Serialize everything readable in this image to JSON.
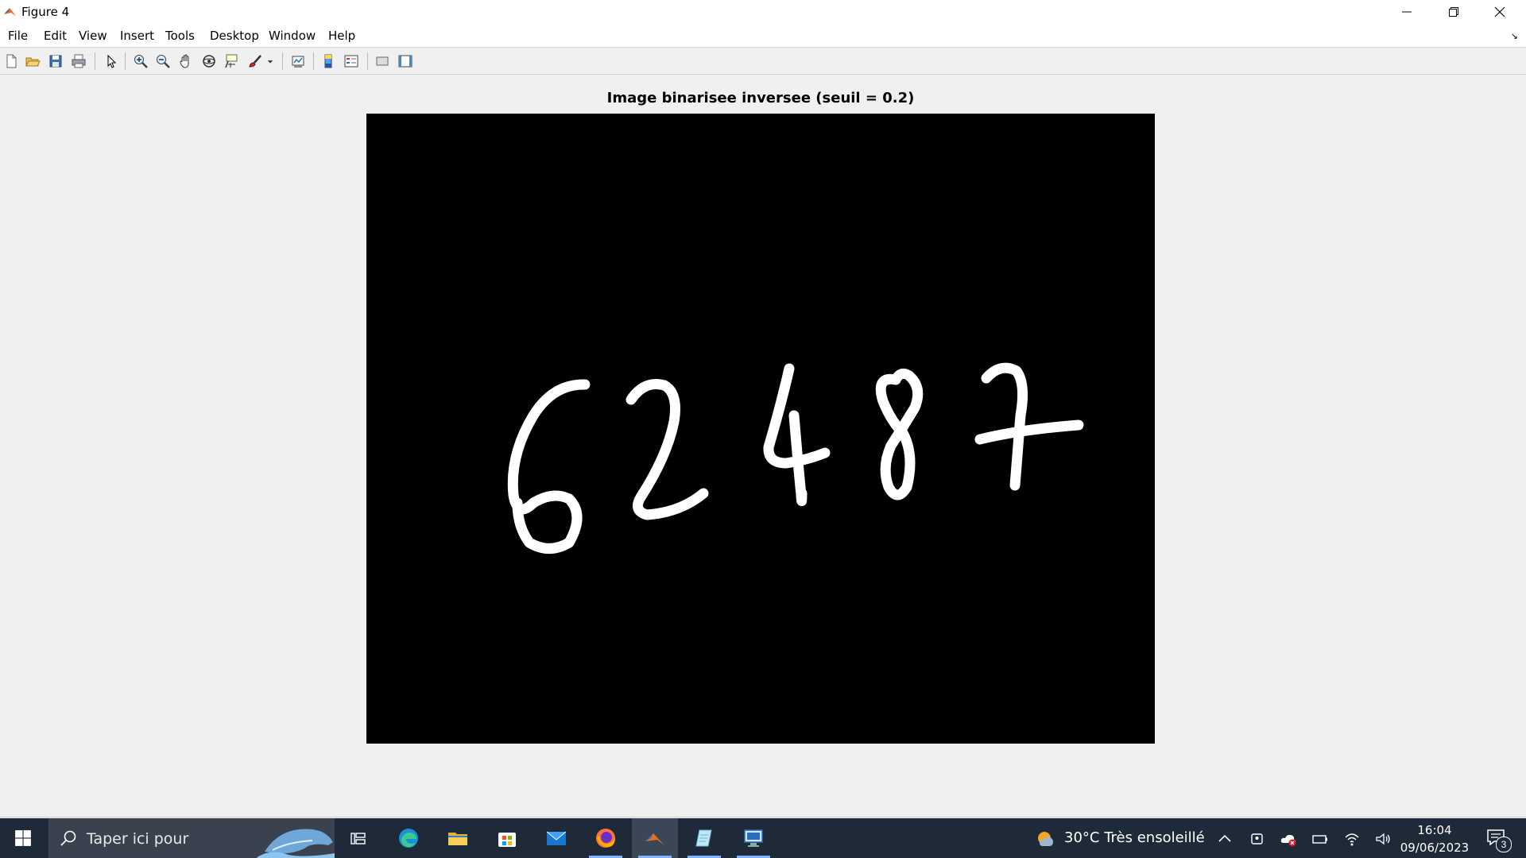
{
  "window": {
    "title": "Figure 4",
    "controls": [
      "minimize",
      "restore",
      "close"
    ]
  },
  "menu": {
    "items": [
      "File",
      "Edit",
      "View",
      "Insert",
      "Tools",
      "Desktop",
      "Window",
      "Help"
    ]
  },
  "toolbar": {
    "buttons": [
      "new-figure-icon",
      "open-file-icon",
      "save-icon",
      "print-icon",
      "edit-plot-icon",
      "zoom-in-icon",
      "zoom-out-icon",
      "pan-icon",
      "rotate-3d-icon",
      "data-cursor-icon",
      "brush-icon",
      "link-plot-icon",
      "insert-colorbar-icon",
      "insert-legend-icon",
      "hide-plot-tools-icon",
      "show-plot-tools-icon"
    ]
  },
  "figure": {
    "title": "Image binarisee inversee (seuil = 0.2)",
    "image": {
      "content": "62487",
      "foreground": "#ffffff",
      "background": "#000000"
    }
  },
  "taskbar": {
    "search_placeholder": "Taper ici pour",
    "weather": "30°C  Très ensoleillé",
    "time": "16:04",
    "date": "09/06/2023",
    "notifications_count": "3",
    "accent": "#7fb3ff",
    "background": "#1f2a38",
    "apps": [
      "task-view-icon",
      "edge-icon",
      "file-explorer-icon",
      "store-icon",
      "mail-icon",
      "firefox-icon",
      "matlab-icon",
      "notepad-icon",
      "remote-desktop-icon"
    ]
  }
}
